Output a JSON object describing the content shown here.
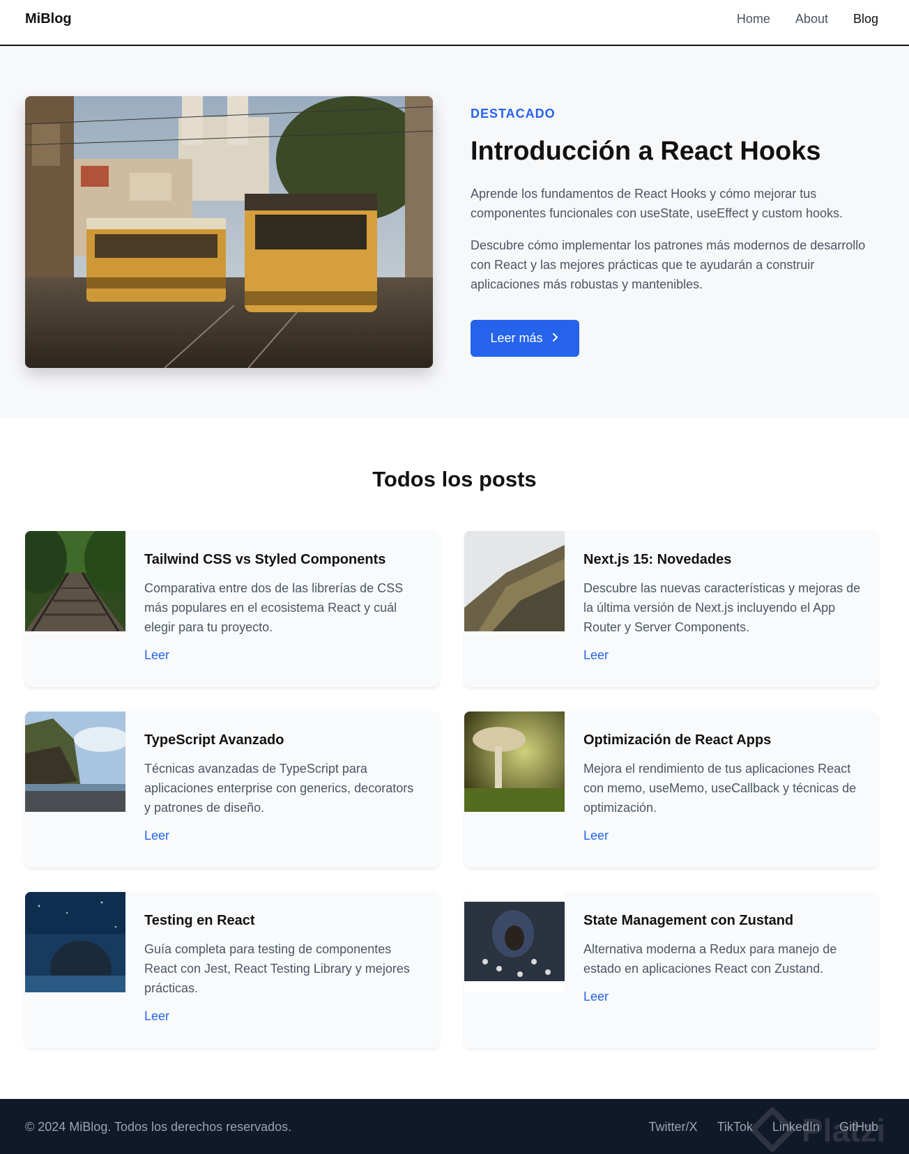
{
  "nav": {
    "logo": "MiBlog",
    "links": [
      {
        "label": "Home"
      },
      {
        "label": "About"
      },
      {
        "label": "Blog"
      }
    ]
  },
  "hero": {
    "eyebrow": "DESTACADO",
    "title": "Introducción a React Hooks",
    "paragraph1": "Aprende los fundamentos de React Hooks y cómo mejorar tus componentes funcionales con useState, useEffect y custom hooks.",
    "paragraph2": "Descubre cómo implementar los patrones más modernos de desarrollo con React y las mejores prácticas que te ayudarán a construir aplicaciones más robustas y mantenibles.",
    "cta_label": "Leer más",
    "cta_icon": "chevron-right-icon"
  },
  "posts": {
    "title": "Todos los posts",
    "items": [
      {
        "title": "Tailwind CSS vs Styled Components",
        "excerpt": "Comparativa entre dos de las librerías de CSS más populares en el ecosistema React y cuál elegir para tu proyecto.",
        "link": "Leer"
      },
      {
        "title": "Next.js 15: Novedades",
        "excerpt": "Descubre las nuevas características y mejoras de la última versión de Next.js incluyendo el App Router y Server Components.",
        "link": "Leer"
      },
      {
        "title": "TypeScript Avanzado",
        "excerpt": "Técnicas avanzadas de TypeScript para aplicaciones enterprise con generics, decorators y patrones de diseño.",
        "link": "Leer"
      },
      {
        "title": "Optimización de React Apps",
        "excerpt": "Mejora el rendimiento de tus aplicaciones React con memo, useMemo, useCallback y técnicas de optimización.",
        "link": "Leer"
      },
      {
        "title": "Testing en React",
        "excerpt": "Guía completa para testing de componentes React con Jest, React Testing Library y mejores prácticas.",
        "link": "Leer"
      },
      {
        "title": "State Management con Zustand",
        "excerpt": "Alternativa moderna a Redux para manejo de estado en aplicaciones React con Zustand.",
        "link": "Leer"
      }
    ]
  },
  "footer": {
    "copyright": "© 2024 MiBlog. Todos los derechos reservados.",
    "links": [
      {
        "label": "Twitter/X"
      },
      {
        "label": "TikTok"
      },
      {
        "label": "LinkedIn"
      },
      {
        "label": "GitHub"
      }
    ],
    "watermark": "Platzi"
  },
  "colors": {
    "accent": "#2563eb",
    "footer_bg": "#111827",
    "hero_bg": "#f7f8fa"
  }
}
